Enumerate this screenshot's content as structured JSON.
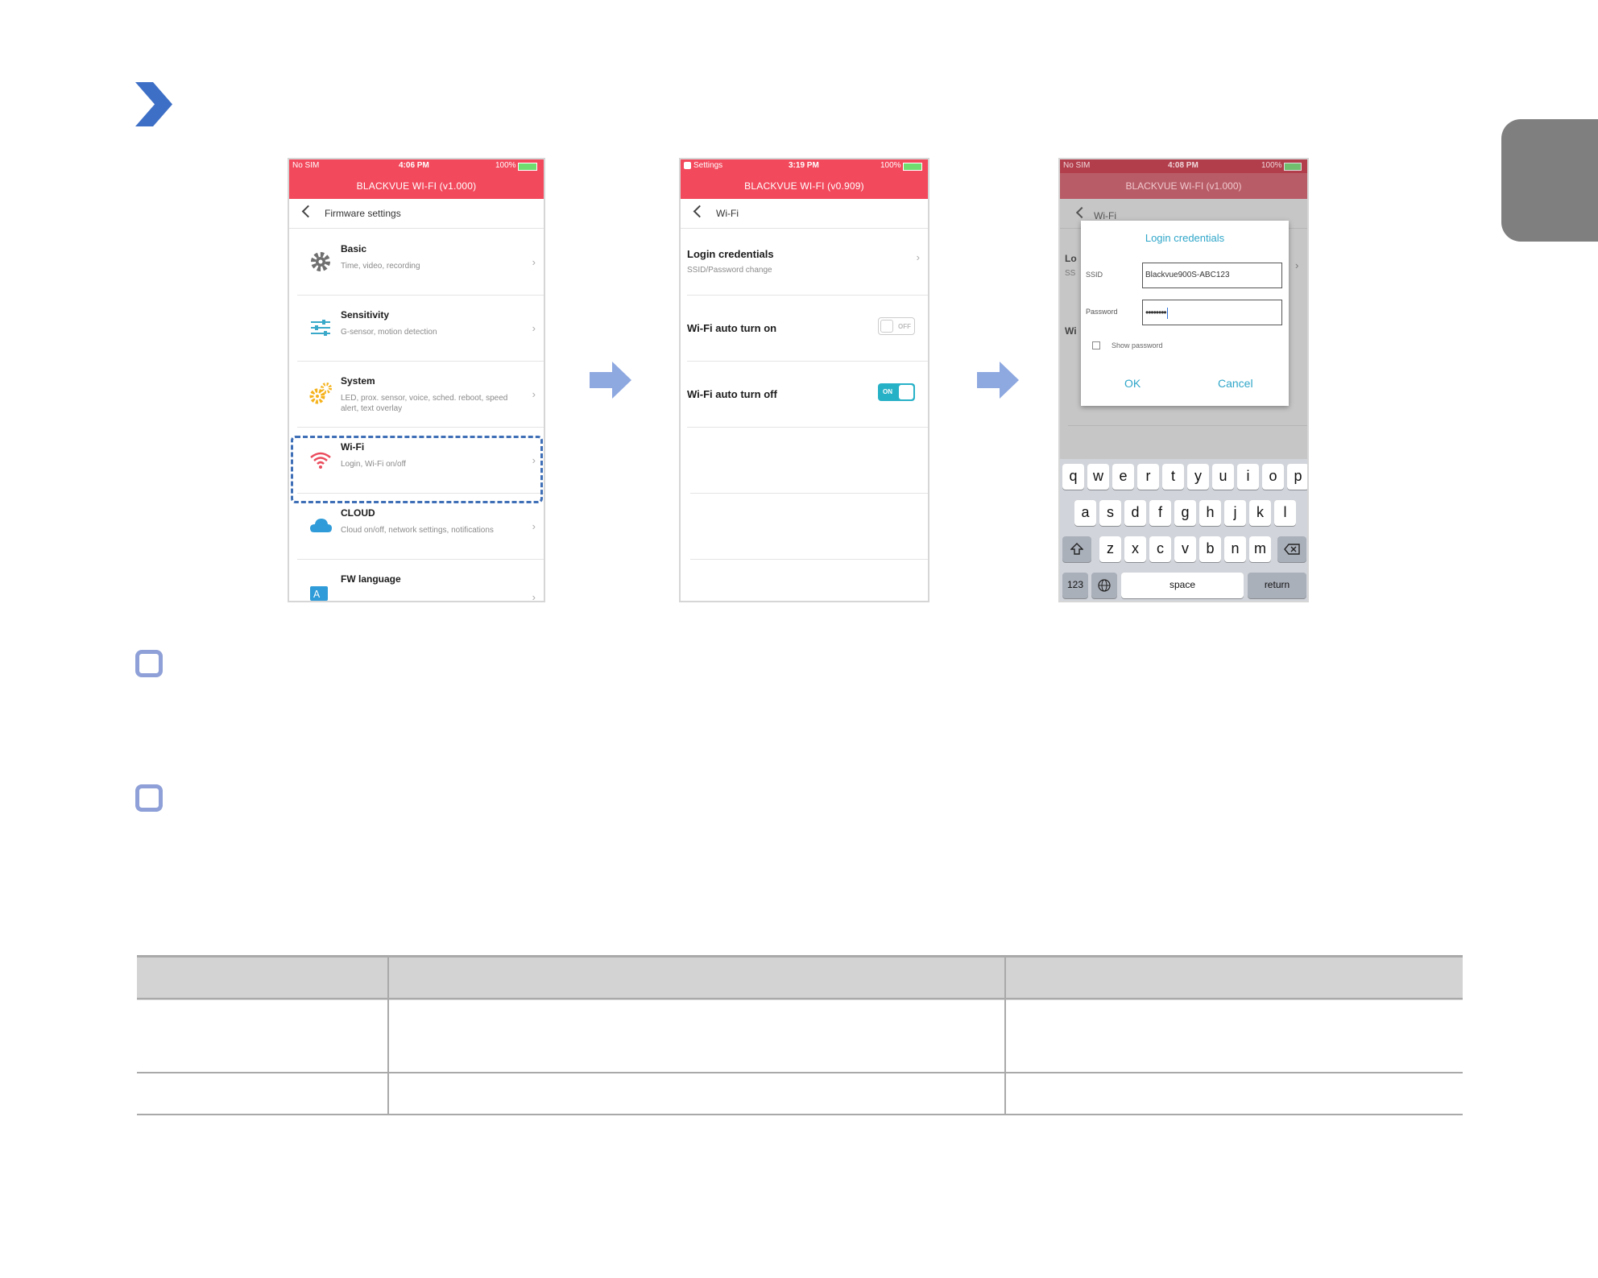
{
  "screen1": {
    "status": {
      "left": "No SIM",
      "time": "4:06 PM",
      "battery": "100%"
    },
    "app_title": "BLACKVUE WI-FI (v1.000)",
    "nav_title": "Firmware settings",
    "items": [
      {
        "title": "Basic",
        "subtitle": "Time, video, recording",
        "icon": "gear-icon"
      },
      {
        "title": "Sensitivity",
        "subtitle": "G-sensor, motion detection",
        "icon": "sliders-icon"
      },
      {
        "title": "System",
        "subtitle": "LED, prox. sensor, voice, sched. reboot, speed alert, text overlay",
        "icon": "gears-icon"
      },
      {
        "title": "Wi-Fi",
        "subtitle": "Login, Wi-Fi on/off",
        "icon": "wifi-icon"
      },
      {
        "title": "CLOUD",
        "subtitle": "Cloud on/off, network settings, notifications",
        "icon": "cloud-icon"
      },
      {
        "title": "FW language",
        "subtitle": "",
        "icon": "language-icon"
      }
    ]
  },
  "screen2": {
    "status": {
      "left": "Settings",
      "time": "3:19 PM",
      "battery": "100%"
    },
    "app_title": "BLACKVUE WI-FI (v0.909)",
    "nav_title": "Wi-Fi",
    "login": {
      "title": "Login credentials",
      "subtitle": "SSID/Password change"
    },
    "auto_on": {
      "label": "Wi-Fi auto turn on",
      "state": "OFF"
    },
    "auto_off": {
      "label": "Wi-Fi auto turn off",
      "state": "ON"
    }
  },
  "screen3": {
    "status": {
      "left": "No SIM",
      "time": "4:08 PM",
      "battery": "100%"
    },
    "app_title": "BLACKVUE WI-FI (v1.000)",
    "nav_title": "Wi-Fi",
    "bg_row1": "Lo",
    "bg_row1_sub": "SS",
    "bg_row2": "Wi",
    "dialog": {
      "title": "Login credentials",
      "ssid_label": "SSID",
      "ssid_value": "Blackvue900S-ABC123",
      "password_label": "Password",
      "password_value": "••••••••",
      "show_password": "Show password",
      "ok": "OK",
      "cancel": "Cancel"
    },
    "keyboard": {
      "row1": [
        "q",
        "w",
        "e",
        "r",
        "t",
        "y",
        "u",
        "i",
        "o",
        "p"
      ],
      "row2": [
        "a",
        "s",
        "d",
        "f",
        "g",
        "h",
        "j",
        "k",
        "l"
      ],
      "row3": [
        "z",
        "x",
        "c",
        "v",
        "b",
        "n",
        "m"
      ],
      "num": "123",
      "space": "space",
      "return": "return"
    }
  },
  "colors": {
    "accent_red": "#f2495c",
    "accent_blue": "#3f6fb6",
    "toggle_on": "#27b1c7"
  }
}
